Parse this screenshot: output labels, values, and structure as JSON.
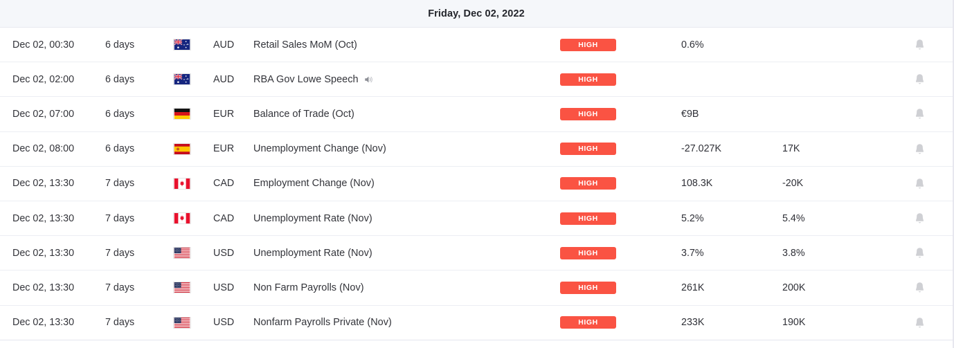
{
  "header": {
    "date_label": "Friday, Dec 02, 2022"
  },
  "colors": {
    "impact_high": "#FA5343",
    "header_bg": "#F5F7FA",
    "row_border": "#ECEEF3",
    "text": "#33343A",
    "bell_gray": "#CFD0D4"
  },
  "icons": {
    "speaker": "speaker-icon",
    "bell": "bell-icon"
  },
  "rows": [
    {
      "time": "Dec 02, 00:30",
      "countdown": "6 days",
      "flag": "australia",
      "currency": "AUD",
      "event": "Retail Sales MoM (Oct)",
      "has_speech_icon": false,
      "impact": "HIGH",
      "actual": "0.6%",
      "forecast": ""
    },
    {
      "time": "Dec 02, 02:00",
      "countdown": "6 days",
      "flag": "australia",
      "currency": "AUD",
      "event": "RBA Gov Lowe Speech",
      "has_speech_icon": true,
      "impact": "HIGH",
      "actual": "",
      "forecast": ""
    },
    {
      "time": "Dec 02, 07:00",
      "countdown": "6 days",
      "flag": "germany",
      "currency": "EUR",
      "event": "Balance of Trade (Oct)",
      "has_speech_icon": false,
      "impact": "HIGH",
      "actual": "€9B",
      "forecast": ""
    },
    {
      "time": "Dec 02, 08:00",
      "countdown": "6 days",
      "flag": "spain",
      "currency": "EUR",
      "event": "Unemployment Change (Nov)",
      "has_speech_icon": false,
      "impact": "HIGH",
      "actual": "-27.027K",
      "forecast": "17K"
    },
    {
      "time": "Dec 02, 13:30",
      "countdown": "7 days",
      "flag": "canada",
      "currency": "CAD",
      "event": "Employment Change (Nov)",
      "has_speech_icon": false,
      "impact": "HIGH",
      "actual": "108.3K",
      "forecast": "-20K"
    },
    {
      "time": "Dec 02, 13:30",
      "countdown": "7 days",
      "flag": "canada",
      "currency": "CAD",
      "event": "Unemployment Rate (Nov)",
      "has_speech_icon": false,
      "impact": "HIGH",
      "actual": "5.2%",
      "forecast": "5.4%"
    },
    {
      "time": "Dec 02, 13:30",
      "countdown": "7 days",
      "flag": "usa",
      "currency": "USD",
      "event": "Unemployment Rate (Nov)",
      "has_speech_icon": false,
      "impact": "HIGH",
      "actual": "3.7%",
      "forecast": "3.8%"
    },
    {
      "time": "Dec 02, 13:30",
      "countdown": "7 days",
      "flag": "usa",
      "currency": "USD",
      "event": "Non Farm Payrolls (Nov)",
      "has_speech_icon": false,
      "impact": "HIGH",
      "actual": "261K",
      "forecast": "200K"
    },
    {
      "time": "Dec 02, 13:30",
      "countdown": "7 days",
      "flag": "usa",
      "currency": "USD",
      "event": "Nonfarm Payrolls Private (Nov)",
      "has_speech_icon": false,
      "impact": "HIGH",
      "actual": "233K",
      "forecast": "190K"
    }
  ]
}
